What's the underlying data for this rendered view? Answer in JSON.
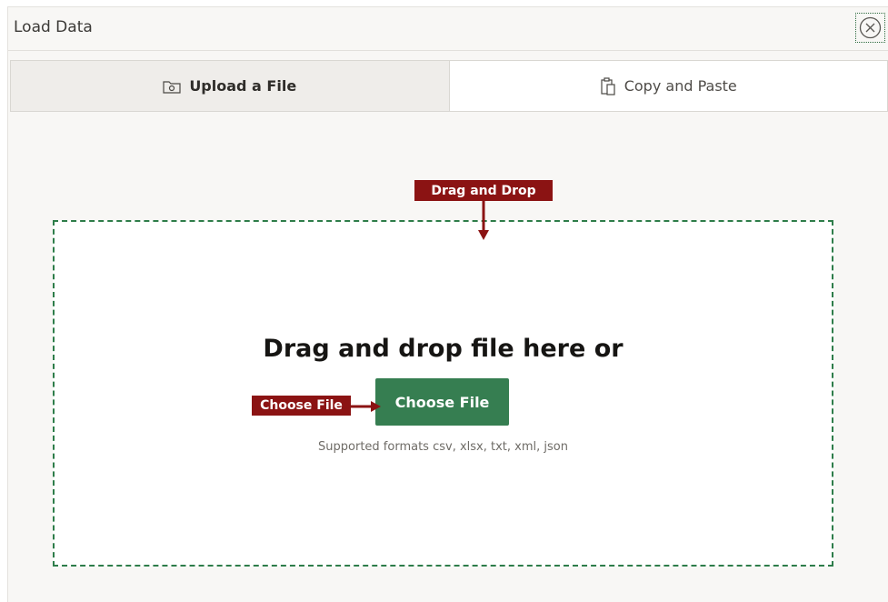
{
  "dialog": {
    "title": "Load Data",
    "close_icon": "close-circle-icon"
  },
  "tabs": [
    {
      "label": "Upload a File",
      "icon": "upload-folder-icon",
      "active": true
    },
    {
      "label": "Copy and Paste",
      "icon": "clipboard-icon",
      "active": false
    }
  ],
  "dropzone": {
    "heading": "Drag and drop file here or",
    "button_label": "Choose File",
    "formats_text": "Supported formats csv, xlsx, txt, xml, json"
  },
  "annotations": {
    "drag_drop": "Drag and Drop",
    "choose_file": "Choose File"
  },
  "colors": {
    "accent_green": "#367e51",
    "dropzone_border": "#2e7d4a",
    "callout_red": "#8b1313"
  }
}
